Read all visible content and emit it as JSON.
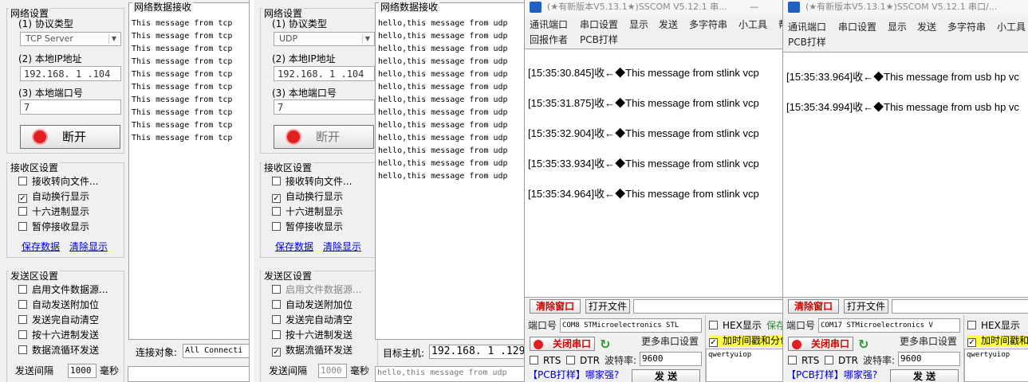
{
  "tcp": {
    "net_settings": "网络设置",
    "proto_label": "(1) 协议类型",
    "proto_value": "TCP Server",
    "ip_label": "(2) 本地IP地址",
    "ip_value": "192.168. 1 .104",
    "port_label": "(3) 本地端口号",
    "port_value": "7",
    "disconnect": "断开",
    "recv_settings": "接收区设置",
    "recv_opts": [
      {
        "t": "接收转向文件...",
        "c": ""
      },
      {
        "t": "自动换行显示",
        "c": "✓"
      },
      {
        "t": "十六进制显示",
        "c": ""
      },
      {
        "t": "暂停接收显示",
        "c": ""
      }
    ],
    "save": "保存数据",
    "clear": "清除显示",
    "send_settings": "发送区设置",
    "send_opts": [
      {
        "t": "启用文件数据源...",
        "c": ""
      },
      {
        "t": "自动发送附加位",
        "c": ""
      },
      {
        "t": "发送完自动清空",
        "c": ""
      },
      {
        "t": "按十六进制发送",
        "c": ""
      },
      {
        "t": "数据流循环发送",
        "c": ""
      }
    ],
    "interval_label": "发送间隔",
    "interval_value": "1000",
    "interval_unit": "毫秒",
    "recv_title": "网络数据接收",
    "messages": [
      "This message from tcp",
      "This message from tcp",
      "This message from tcp",
      "This message from tcp",
      "This message from tcp",
      "This message from tcp",
      "This message from tcp",
      "This message from tcp",
      "This message from tcp",
      "This message from tcp"
    ],
    "conn_label": "连接对象:",
    "conn_value": "All Connecti"
  },
  "udp": {
    "net_settings": "网络设置",
    "proto_label": "(1) 协议类型",
    "proto_value": "UDP",
    "ip_label": "(2) 本地IP地址",
    "ip_value": "192.168. 1 .104",
    "port_label": "(3) 本地端口号",
    "port_value": "7",
    "disconnect": "断开",
    "recv_settings": "接收区设置",
    "recv_opts": [
      {
        "t": "接收转向文件...",
        "c": ""
      },
      {
        "t": "自动换行显示",
        "c": "✓"
      },
      {
        "t": "十六进制显示",
        "c": ""
      },
      {
        "t": "暂停接收显示",
        "c": ""
      }
    ],
    "save": "保存数据",
    "clear": "清除显示",
    "send_settings": "发送区设置",
    "send_opts": [
      {
        "t": "启用文件数据源...",
        "c": ""
      },
      {
        "t": "自动发送附加位",
        "c": ""
      },
      {
        "t": "发送完自动清空",
        "c": ""
      },
      {
        "t": "按十六进制发送",
        "c": ""
      },
      {
        "t": "数据流循环发送",
        "c": "✓"
      }
    ],
    "interval_label": "发送间隔",
    "interval_value": "1000",
    "interval_unit": "毫秒",
    "recv_title": "网络数据接收",
    "messages": [
      "hello,this message from udp",
      "hello,this message from udp",
      "hello,this message from udp",
      "hello,this message from udp",
      "hello,this message from udp",
      "hello,this message from udp",
      "hello,this message from udp",
      "hello,this message from udp",
      "hello,this message from udp",
      "hello,this message from udp",
      "hello,this message from udp",
      "hello,this message from udp",
      "hello,this message from udp"
    ],
    "host_label": "目标主机:",
    "host_value": "192.168. 1 .129",
    "send_text": "hello,this message from udp"
  },
  "sscom1": {
    "title": "(★有新版本V5.13.1★)SSCOM V5.12.1 串...",
    "min": "—",
    "menu1": [
      "通讯端口",
      "串口设置",
      "显示",
      "发送",
      "多字符串",
      "小工具",
      "帮"
    ],
    "menu2": [
      "回报作者",
      "PCB打样"
    ],
    "lines": [
      "[15:35:30.845]收←◆This message from stlink vcp",
      "[15:35:31.875]收←◆This message from stlink vcp",
      "[15:35:32.904]收←◆This message from stlink vcp",
      "[15:35:33.934]收←◆This message from stlink vcp",
      "[15:35:34.964]收←◆This message from stlink vcp"
    ],
    "clear_btn": "清除窗口",
    "open_file": "打开文件",
    "port_label": "端口号",
    "port_value": "COM8 STMicroelectronics STL",
    "close_port": "关闭串口",
    "more_settings": "更多串口设置",
    "rts": "RTS",
    "dtr": "DTR",
    "baud_label": "波特率:",
    "baud_value": "9600",
    "hex_show": "HEX显示",
    "save": "保存",
    "timestamp": "加时间戳和分包",
    "send_input": "qwertyuiop",
    "pcb": "【PCB打样】哪家强?",
    "send_btn": "发 送"
  },
  "sscom2": {
    "title": "(★有新版本V5.13.1★)SSCOM V5.12.1 串口/...",
    "menu1": [
      "通讯端口",
      "串口设置",
      "显示",
      "发送",
      "多字符串",
      "小工具"
    ],
    "menu2": [
      "PCB打样"
    ],
    "lines": [
      "[15:35:33.964]收←◆This  message from usb hp vc",
      "[15:35:34.994]收←◆This  message from usb hp vc"
    ],
    "clear_btn": "清除窗口",
    "open_file": "打开文件",
    "port_label": "端口号",
    "port_value": "COM17 STMicroelectronics V",
    "close_port": "关闭串口",
    "more_settings": "更多串口设置",
    "rts": "RTS",
    "dtr": "DTR",
    "baud_label": "波特率:",
    "baud_value": "9600",
    "hex_show": "HEX显示",
    "timestamp": "加时间戳和",
    "send_input": "qwertyuiop",
    "pcb": "【PCB打样】哪家强?",
    "send_btn": "发 送"
  }
}
